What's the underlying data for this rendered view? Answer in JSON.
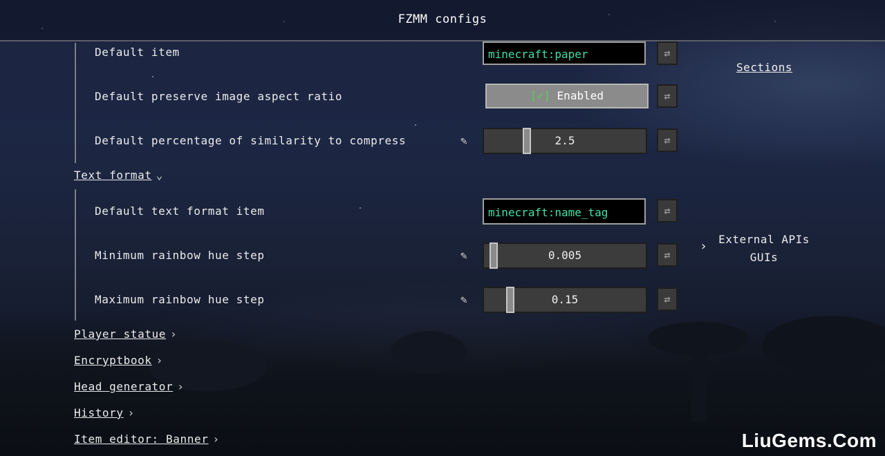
{
  "window": {
    "title": "FZMM configs"
  },
  "image_section": {
    "default_item": {
      "label": "Default item",
      "value": "minecraft:paper"
    },
    "preserve_aspect": {
      "label": "Default preserve image aspect ratio",
      "value": "Enabled",
      "checkbox": "[✓]",
      "checked": true
    },
    "similarity": {
      "label": "Default percentage of similarity to compress",
      "value": "2.5"
    }
  },
  "text_format": {
    "header": "Text format",
    "default_item": {
      "label": "Default text format item",
      "value": "minecraft:name_tag"
    },
    "min_hue": {
      "label": "Minimum rainbow hue step",
      "value": "0.005"
    },
    "max_hue": {
      "label": "Maximum rainbow hue step",
      "value": "0.15"
    }
  },
  "collapsed_sections": [
    "Player statue",
    "Encryptbook",
    "Head generator",
    "History",
    "Item editor: Banner"
  ],
  "sidebar": {
    "title": "Sections",
    "entry_line1": "External APIs",
    "entry_line2": "GUIs"
  },
  "icons": {
    "reset": "⇄",
    "edit": "✎",
    "chevron_right": "›",
    "chevron_down": "⌄"
  },
  "watermark": "LiuGems.Com"
}
